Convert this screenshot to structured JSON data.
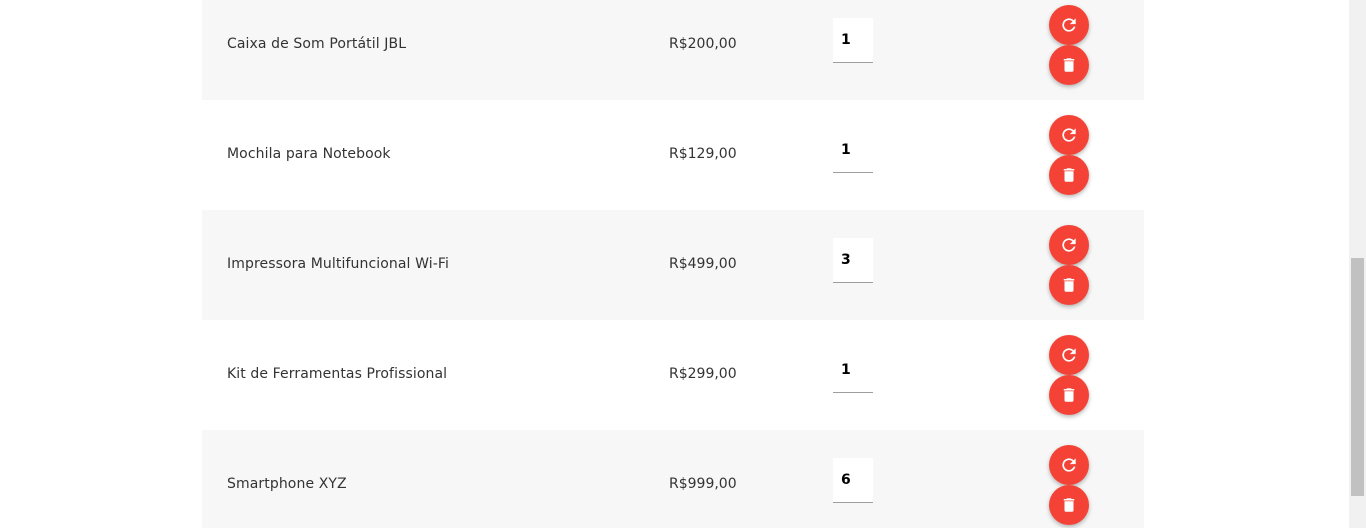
{
  "cart": {
    "items": [
      {
        "name": "Caixa de Som Portátil JBL",
        "price": "R$200,00",
        "quantity": "1"
      },
      {
        "name": "Mochila para Notebook",
        "price": "R$129,00",
        "quantity": "1"
      },
      {
        "name": "Impressora Multifuncional Wi-Fi",
        "price": "R$499,00",
        "quantity": "3"
      },
      {
        "name": "Kit de Ferramentas Profissional",
        "price": "R$299,00",
        "quantity": "1"
      },
      {
        "name": "Smartphone XYZ",
        "price": "R$999,00",
        "quantity": "6"
      }
    ]
  },
  "icons": {
    "update": "refresh-icon",
    "remove": "trash-icon"
  },
  "colors": {
    "accent": "#f44336",
    "row_alt": "#f7f7f7",
    "text": "#333333"
  }
}
